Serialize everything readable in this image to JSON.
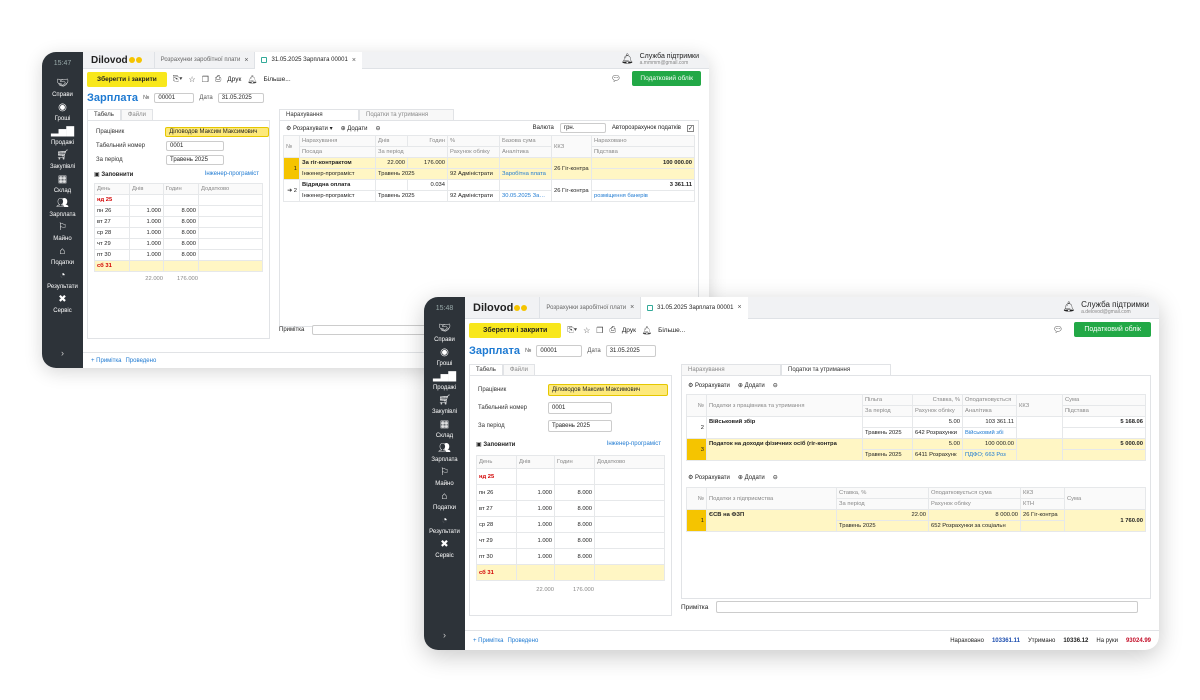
{
  "app": {
    "logo": "Dilovod",
    "support_title": "Служба підтримки",
    "support_email": "a.delovod@gmail.com",
    "support_email_short": "a.mmmm@gmail.com"
  },
  "sidebar": {
    "time1": "15:47",
    "time2": "15:48",
    "items": [
      "Справи",
      "Гроші",
      "Продажі",
      "Закупівлі",
      "Склад",
      "Зарплата",
      "Майно",
      "Податки",
      "Результати",
      "Сервіс"
    ],
    "expand": "›"
  },
  "tabs": {
    "t1": "Розрахунки заробітної плати",
    "t2": "31.05.2025 Зарплата 00001"
  },
  "toolbar": {
    "save": "Зберегти і закрити",
    "print": "Друк",
    "more": "Більше...",
    "tax": "Податковий облік"
  },
  "doc": {
    "title": "Зарплата",
    "num_label": "№",
    "num": "00001",
    "date_label": "Дата",
    "date": "31.05.2025"
  },
  "left": {
    "tab_timesheet": "Табель",
    "tab_files": "Файли",
    "employee_label": "Працівник",
    "employee": "Діловодов Максим Максимович",
    "tabnum_label": "Табельний номер",
    "tabnum": "0001",
    "period_label": "За період",
    "period": "Травень 2025",
    "fill": "Заповнити",
    "position": "Інженер-програміст",
    "cols": [
      "День",
      "Днів",
      "Годин",
      "Додатково"
    ],
    "rows": [
      {
        "d": "нд 25",
        "n": "",
        "h": ""
      },
      {
        "d": "пн 26",
        "n": "1.000",
        "h": "8.000"
      },
      {
        "d": "вт 27",
        "n": "1.000",
        "h": "8.000"
      },
      {
        "d": "ср 28",
        "n": "1.000",
        "h": "8.000"
      },
      {
        "d": "чт 29",
        "n": "1.000",
        "h": "8.000"
      },
      {
        "d": "пт 30",
        "n": "1.000",
        "h": "8.000"
      },
      {
        "d": "сб 31",
        "n": "",
        "h": ""
      }
    ],
    "total_days": "22.000",
    "total_hours": "176.000"
  },
  "w1": {
    "tab_accr": "Нарахування",
    "tab_tax": "Податки та утримання",
    "calc": "Розрахувати",
    "add": "Додати",
    "currency_label": "Валюта",
    "currency": "грн.",
    "autocalc": "Авторозрахунок податків",
    "h1": [
      "№",
      "Нарахування",
      "Днів",
      "Годин",
      "%",
      "Базова сума",
      "ККЗ",
      "Нараховано"
    ],
    "h2": [
      "Посада",
      "За період",
      "Рахунок обліку",
      "Аналітика",
      "Підстава"
    ],
    "r1": {
      "n": "1",
      "name": "За гіг-контрактом",
      "days": "22.000",
      "hours": "176.000",
      "kkz": "26 Гіг-контра",
      "sum": "100 000.00",
      "pos": "Інженер-програміст",
      "per": "Травень 2025",
      "acc": "92 Адміністрати",
      "an": "Заробітна плата"
    },
    "r2": {
      "n": "2",
      "name": "Відрядна оплата",
      "hours": "0.034",
      "kkz": "26 Гіг-контра",
      "sum": "3 361.11",
      "pos": "Інженер-програміст",
      "per": "Травень 2025",
      "acc": "92 Адміністрати",
      "an": "30.05.2025 Замов",
      "basis": "розміщення банерів"
    },
    "note": "Примітка"
  },
  "w2": {
    "tab_accr": "Нарахування",
    "tab_tax": "Податки та утримання",
    "calc": "Розрахувати",
    "add": "Додати",
    "h1": [
      "№",
      "Податки з працівника та утримання",
      "Пільга",
      "Ставка, %",
      "Оподатковується",
      "ККЗ",
      "Сума"
    ],
    "h2": [
      "За період",
      "Рахунок обліку",
      "Аналітика",
      "Підстава"
    ],
    "r1": {
      "n": "2",
      "name": "Військовий збір",
      "rate": "5.00",
      "base": "103 361.11",
      "sum": "5 168.06",
      "per": "Травень 2025",
      "acc": "642 Розрахунки",
      "an": "Військовий збі"
    },
    "r2": {
      "n": "3",
      "name": "Податок на доходи фізичних осіб (гіг-контра",
      "rate": "5.00",
      "base": "100 000.00",
      "sum": "5 000.00",
      "per": "Травень 2025",
      "acc": "6411 Розрахунк",
      "an": "ПДФО; 663 Роз"
    },
    "calc2": "Розрахувати",
    "add2": "Додати",
    "eh1": [
      "№",
      "Податки з підприємства",
      "Ставка, %",
      "Оподатковується сума",
      "ККЗ",
      "Сума"
    ],
    "eh2": [
      "За період",
      "Рахунок обліку",
      "КТН"
    ],
    "e1": {
      "n": "1",
      "name": "ЄСВ на ФЗП",
      "rate": "22.00",
      "base": "8 000.00",
      "kkz": "26 Гіг-контра",
      "sum": "1 760.00",
      "per": "Травень 2025",
      "acc": "652 Розрахунки за соціальн"
    },
    "note": "Примітка"
  },
  "status": {
    "note": "+ Примітка",
    "posted": "Проведено",
    "accr_label": "Нараховано",
    "accr": "103361.11",
    "ded_label": "Утримано",
    "ded": "10336.12",
    "net_label": "На руки",
    "net": "93024.99"
  }
}
